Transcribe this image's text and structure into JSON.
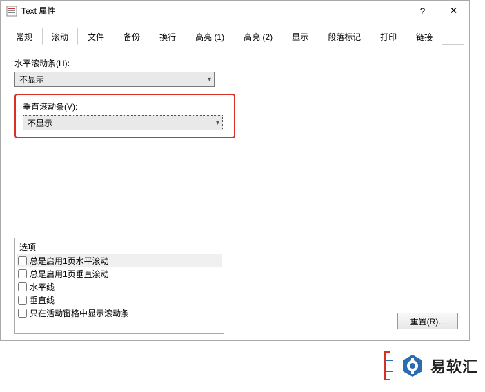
{
  "window": {
    "title": "Text 属性",
    "help": "?",
    "close": "✕"
  },
  "tabs": [
    {
      "label": "常规",
      "active": false
    },
    {
      "label": "滚动",
      "active": true
    },
    {
      "label": "文件",
      "active": false
    },
    {
      "label": "备份",
      "active": false
    },
    {
      "label": "换行",
      "active": false
    },
    {
      "label": "高亮 (1)",
      "active": false
    },
    {
      "label": "高亮 (2)",
      "active": false
    },
    {
      "label": "显示",
      "active": false
    },
    {
      "label": "段落标记",
      "active": false
    },
    {
      "label": "打印",
      "active": false
    },
    {
      "label": "链接",
      "active": false
    }
  ],
  "fields": {
    "hscroll": {
      "label": "水平滚动条(H):",
      "value": "不显示"
    },
    "vscroll": {
      "label": "垂直滚动条(V):",
      "value": "不显示"
    }
  },
  "options": {
    "header": "选项",
    "items": [
      {
        "label": "总是启用1页水平滚动",
        "checked": false,
        "sel": true
      },
      {
        "label": "总是启用1页垂直滚动",
        "checked": false,
        "sel": false
      },
      {
        "label": "水平线",
        "checked": false,
        "sel": false
      },
      {
        "label": "垂直线",
        "checked": false,
        "sel": false
      },
      {
        "label": "只在活动窗格中显示滚动条",
        "checked": false,
        "sel": false
      }
    ]
  },
  "footer": {
    "reset": "重置(R)..."
  },
  "watermark": {
    "brand": "易软汇"
  }
}
